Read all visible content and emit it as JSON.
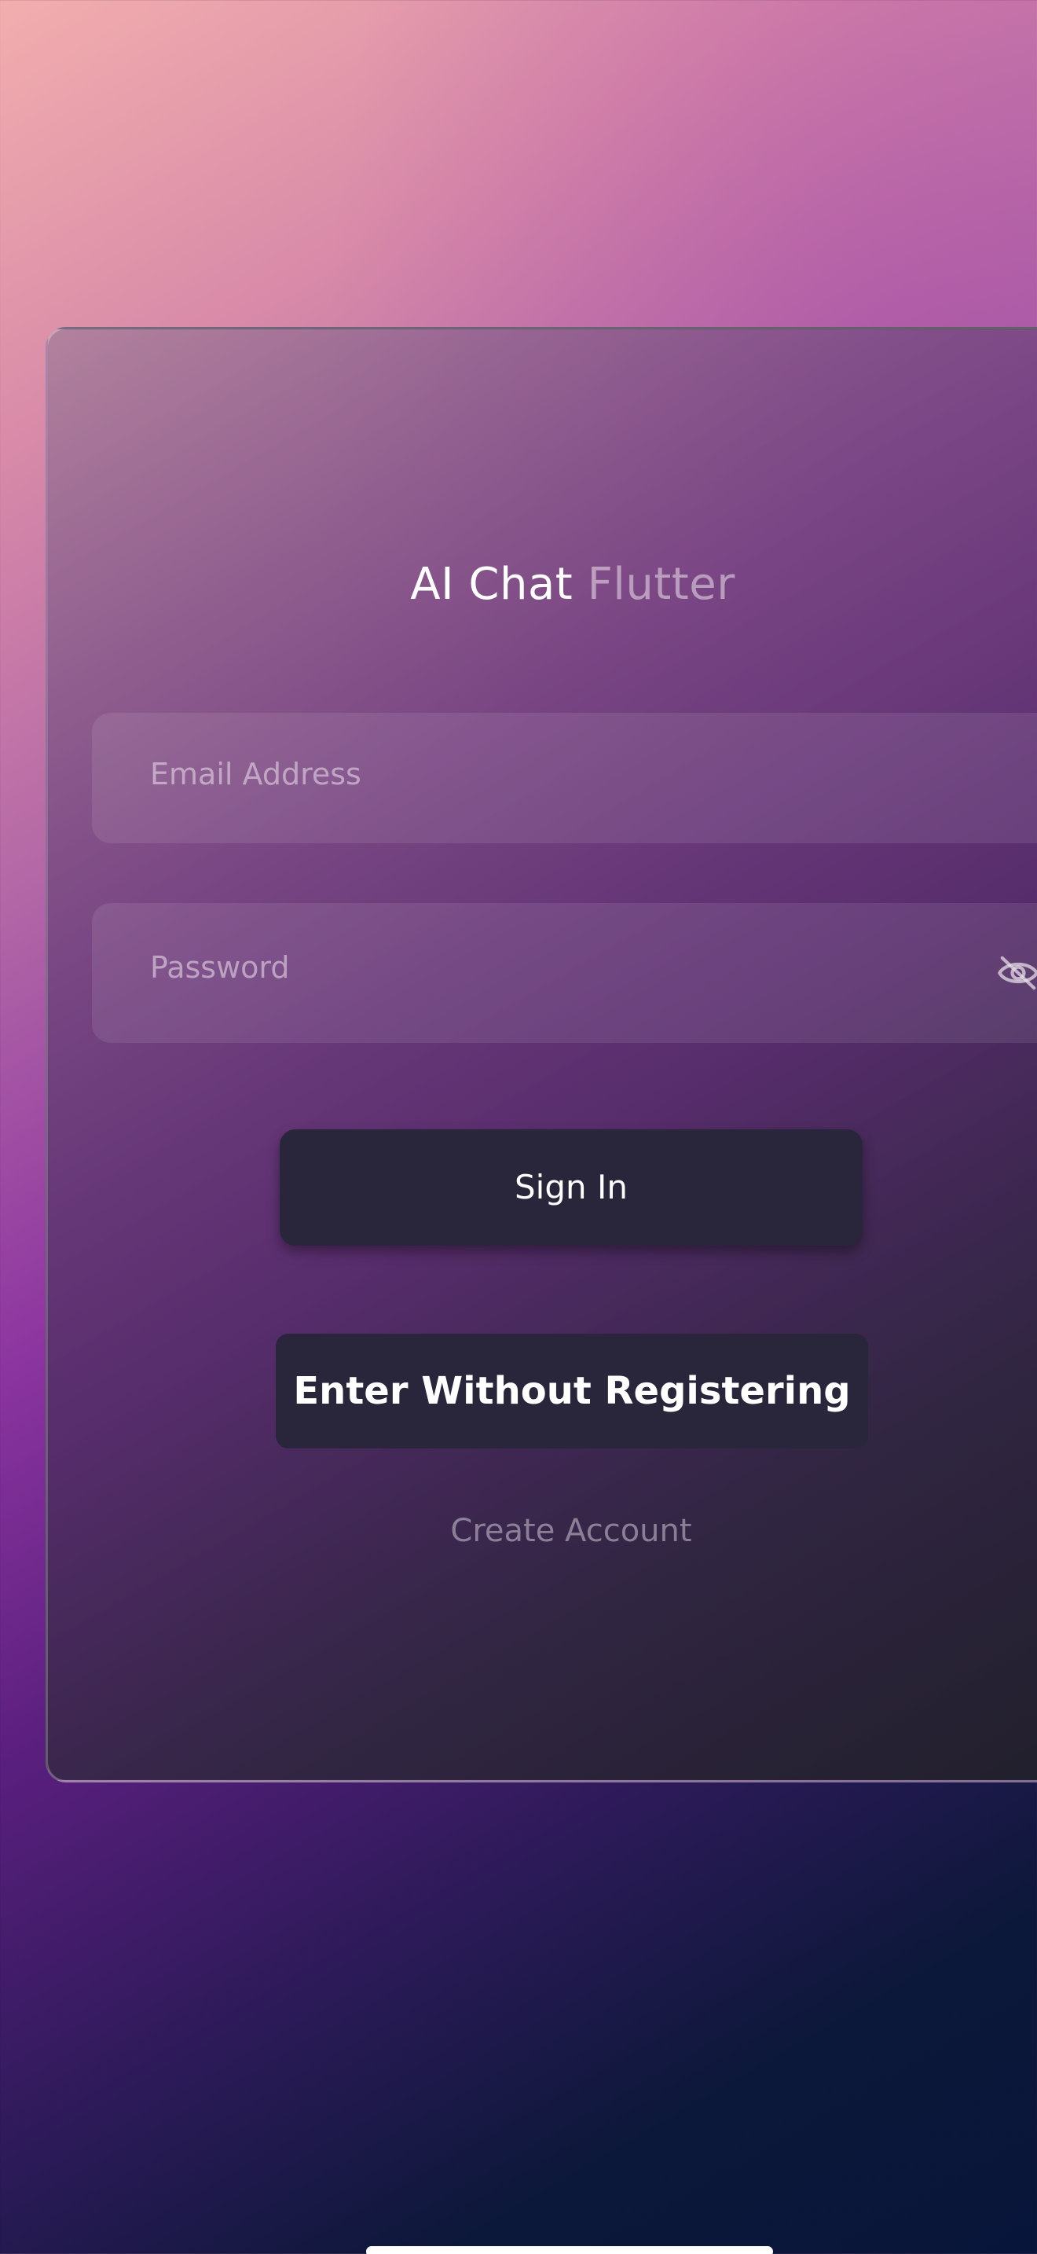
{
  "app": {
    "title_main": "AI Chat",
    "title_accent": "Flutter"
  },
  "login": {
    "email_placeholder": "Email Address",
    "password_placeholder": "Password",
    "password_toggle_icon": "eye-off-icon",
    "sign_in_label": "Sign In",
    "guest_label": "Enter Without Registering",
    "create_account_label": "Create Account"
  },
  "colors": {
    "button_bg": "#29253a",
    "background_top": "#f2aeae",
    "background_mid": "#8c35a0",
    "background_bottom": "#08153a"
  }
}
